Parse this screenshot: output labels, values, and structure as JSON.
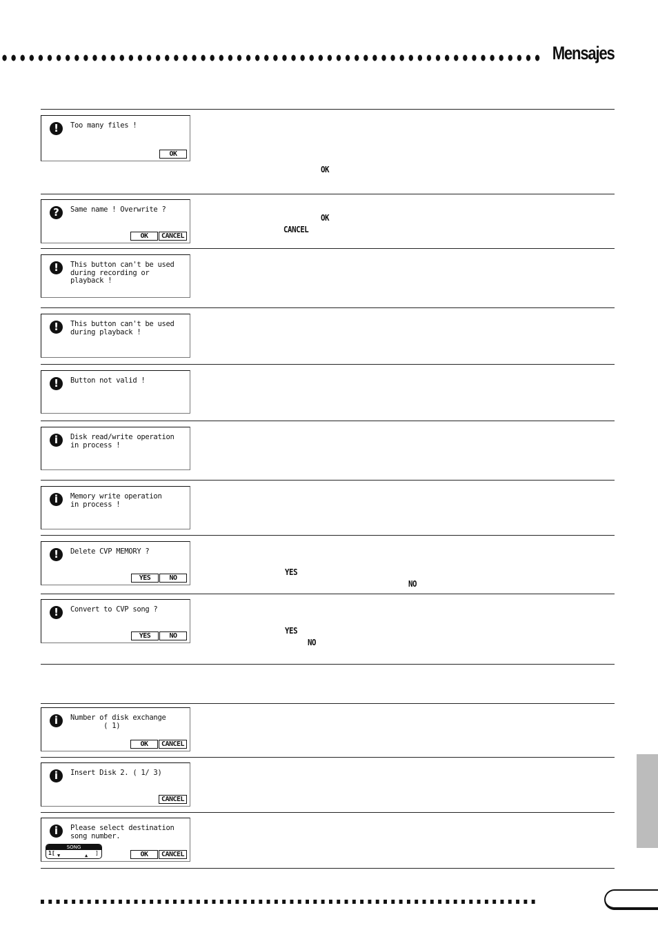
{
  "header": {
    "title": "Mensajes"
  },
  "dialogs": [
    {
      "icon": "!",
      "icon_name": "exclamation-icon",
      "text": "Too many files !",
      "buttons": [
        "OK"
      ]
    },
    {
      "icon": "?",
      "icon_name": "question-icon",
      "text": "Same name ! Overwrite ?",
      "buttons": [
        "OK",
        "CANCEL"
      ]
    },
    {
      "icon": "!",
      "icon_name": "exclamation-icon",
      "text": "This button can't be used\nduring recording or\nplayback !",
      "buttons": []
    },
    {
      "icon": "!",
      "icon_name": "exclamation-icon",
      "text": "This button can't be used\nduring playback !",
      "buttons": []
    },
    {
      "icon": "!",
      "icon_name": "exclamation-icon",
      "text": "Button not valid !",
      "buttons": []
    },
    {
      "icon": "i",
      "icon_name": "info-icon",
      "text": "Disk read/write operation\nin process !",
      "buttons": []
    },
    {
      "icon": "i",
      "icon_name": "info-icon",
      "text": "Memory write operation\nin process !",
      "buttons": []
    },
    {
      "icon": "!",
      "icon_name": "exclamation-icon",
      "text": "Delete CVP MEMORY ?",
      "buttons": [
        "YES",
        "NO"
      ]
    },
    {
      "icon": "!",
      "icon_name": "exclamation-icon",
      "text": "Convert to CVP song ?",
      "buttons": [
        "YES",
        "NO"
      ]
    },
    {
      "icon": "i",
      "icon_name": "info-icon",
      "text": "Number of disk exchange\n        ( 1)",
      "buttons": [
        "OK",
        "CANCEL"
      ]
    },
    {
      "icon": "i",
      "icon_name": "info-icon",
      "text": "Insert Disk 2. ( 1/ 3)",
      "buttons": [
        "CANCEL"
      ]
    },
    {
      "icon": "i",
      "icon_name": "info-icon",
      "text": "Please select destination\nsong number.",
      "buttons": [
        "OK",
        "CANCEL"
      ],
      "song_selector": {
        "label": "SONG",
        "value": "1",
        "open": "[",
        "close": "]",
        "down": "▼",
        "up": "▲"
      }
    }
  ],
  "description_refs": {
    "r0_ok": "OK",
    "r1_ok": "OK",
    "r1_cancel": "CANCEL",
    "r7_yes": "YES",
    "r7_no": "NO",
    "r8_yes": "YES",
    "r8_no": "NO"
  }
}
